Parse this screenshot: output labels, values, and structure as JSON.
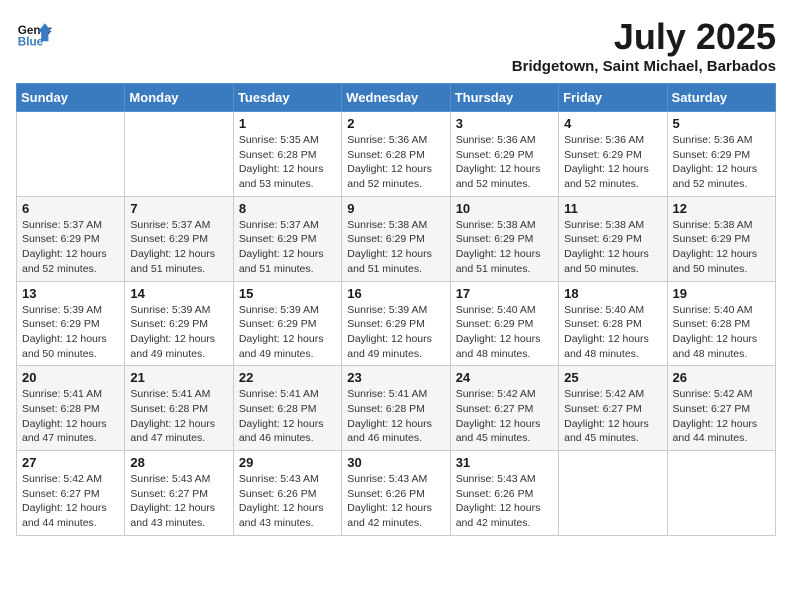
{
  "logo": {
    "line1": "General",
    "line2": "Blue"
  },
  "title": "July 2025",
  "subtitle": "Bridgetown, Saint Michael, Barbados",
  "days_of_week": [
    "Sunday",
    "Monday",
    "Tuesday",
    "Wednesday",
    "Thursday",
    "Friday",
    "Saturday"
  ],
  "weeks": [
    [
      {
        "day": "",
        "info": ""
      },
      {
        "day": "",
        "info": ""
      },
      {
        "day": "1",
        "info": "Sunrise: 5:35 AM\nSunset: 6:28 PM\nDaylight: 12 hours and 53 minutes."
      },
      {
        "day": "2",
        "info": "Sunrise: 5:36 AM\nSunset: 6:28 PM\nDaylight: 12 hours and 52 minutes."
      },
      {
        "day": "3",
        "info": "Sunrise: 5:36 AM\nSunset: 6:29 PM\nDaylight: 12 hours and 52 minutes."
      },
      {
        "day": "4",
        "info": "Sunrise: 5:36 AM\nSunset: 6:29 PM\nDaylight: 12 hours and 52 minutes."
      },
      {
        "day": "5",
        "info": "Sunrise: 5:36 AM\nSunset: 6:29 PM\nDaylight: 12 hours and 52 minutes."
      }
    ],
    [
      {
        "day": "6",
        "info": "Sunrise: 5:37 AM\nSunset: 6:29 PM\nDaylight: 12 hours and 52 minutes."
      },
      {
        "day": "7",
        "info": "Sunrise: 5:37 AM\nSunset: 6:29 PM\nDaylight: 12 hours and 51 minutes."
      },
      {
        "day": "8",
        "info": "Sunrise: 5:37 AM\nSunset: 6:29 PM\nDaylight: 12 hours and 51 minutes."
      },
      {
        "day": "9",
        "info": "Sunrise: 5:38 AM\nSunset: 6:29 PM\nDaylight: 12 hours and 51 minutes."
      },
      {
        "day": "10",
        "info": "Sunrise: 5:38 AM\nSunset: 6:29 PM\nDaylight: 12 hours and 51 minutes."
      },
      {
        "day": "11",
        "info": "Sunrise: 5:38 AM\nSunset: 6:29 PM\nDaylight: 12 hours and 50 minutes."
      },
      {
        "day": "12",
        "info": "Sunrise: 5:38 AM\nSunset: 6:29 PM\nDaylight: 12 hours and 50 minutes."
      }
    ],
    [
      {
        "day": "13",
        "info": "Sunrise: 5:39 AM\nSunset: 6:29 PM\nDaylight: 12 hours and 50 minutes."
      },
      {
        "day": "14",
        "info": "Sunrise: 5:39 AM\nSunset: 6:29 PM\nDaylight: 12 hours and 49 minutes."
      },
      {
        "day": "15",
        "info": "Sunrise: 5:39 AM\nSunset: 6:29 PM\nDaylight: 12 hours and 49 minutes."
      },
      {
        "day": "16",
        "info": "Sunrise: 5:39 AM\nSunset: 6:29 PM\nDaylight: 12 hours and 49 minutes."
      },
      {
        "day": "17",
        "info": "Sunrise: 5:40 AM\nSunset: 6:29 PM\nDaylight: 12 hours and 48 minutes."
      },
      {
        "day": "18",
        "info": "Sunrise: 5:40 AM\nSunset: 6:28 PM\nDaylight: 12 hours and 48 minutes."
      },
      {
        "day": "19",
        "info": "Sunrise: 5:40 AM\nSunset: 6:28 PM\nDaylight: 12 hours and 48 minutes."
      }
    ],
    [
      {
        "day": "20",
        "info": "Sunrise: 5:41 AM\nSunset: 6:28 PM\nDaylight: 12 hours and 47 minutes."
      },
      {
        "day": "21",
        "info": "Sunrise: 5:41 AM\nSunset: 6:28 PM\nDaylight: 12 hours and 47 minutes."
      },
      {
        "day": "22",
        "info": "Sunrise: 5:41 AM\nSunset: 6:28 PM\nDaylight: 12 hours and 46 minutes."
      },
      {
        "day": "23",
        "info": "Sunrise: 5:41 AM\nSunset: 6:28 PM\nDaylight: 12 hours and 46 minutes."
      },
      {
        "day": "24",
        "info": "Sunrise: 5:42 AM\nSunset: 6:27 PM\nDaylight: 12 hours and 45 minutes."
      },
      {
        "day": "25",
        "info": "Sunrise: 5:42 AM\nSunset: 6:27 PM\nDaylight: 12 hours and 45 minutes."
      },
      {
        "day": "26",
        "info": "Sunrise: 5:42 AM\nSunset: 6:27 PM\nDaylight: 12 hours and 44 minutes."
      }
    ],
    [
      {
        "day": "27",
        "info": "Sunrise: 5:42 AM\nSunset: 6:27 PM\nDaylight: 12 hours and 44 minutes."
      },
      {
        "day": "28",
        "info": "Sunrise: 5:43 AM\nSunset: 6:27 PM\nDaylight: 12 hours and 43 minutes."
      },
      {
        "day": "29",
        "info": "Sunrise: 5:43 AM\nSunset: 6:26 PM\nDaylight: 12 hours and 43 minutes."
      },
      {
        "day": "30",
        "info": "Sunrise: 5:43 AM\nSunset: 6:26 PM\nDaylight: 12 hours and 42 minutes."
      },
      {
        "day": "31",
        "info": "Sunrise: 5:43 AM\nSunset: 6:26 PM\nDaylight: 12 hours and 42 minutes."
      },
      {
        "day": "",
        "info": ""
      },
      {
        "day": "",
        "info": ""
      }
    ]
  ]
}
